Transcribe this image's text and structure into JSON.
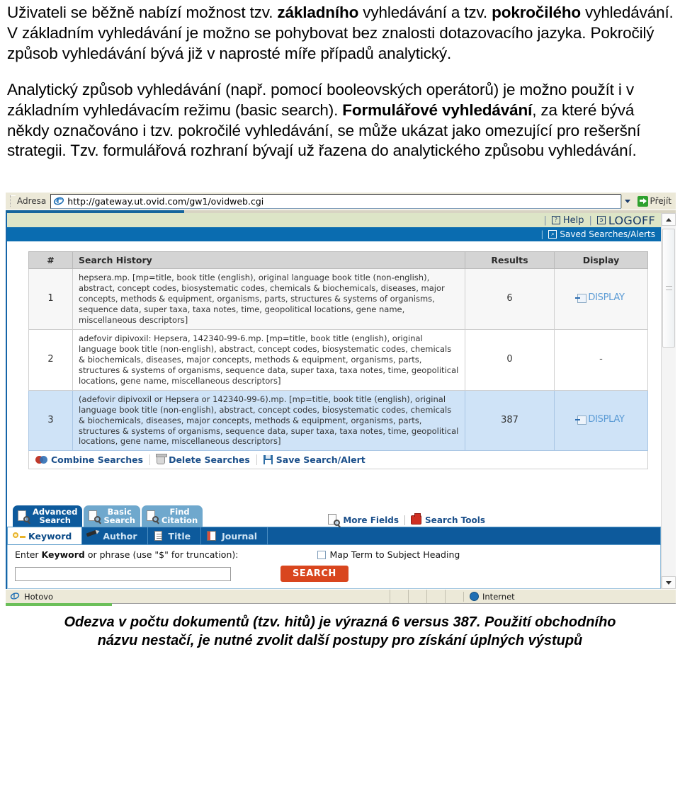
{
  "document": {
    "paragraph1_parts": [
      {
        "t": "Uživateli se běžně nabízí možnost tzv. ",
        "b": false
      },
      {
        "t": "základního",
        "b": true
      },
      {
        "t": " vyhledávání a tzv. ",
        "b": false
      },
      {
        "t": "pokročilého",
        "b": true
      },
      {
        "t": " vyhledávání. V základním vyhledávání je možno se pohybovat bez znalosti dotazovacího jazyka. Pokročilý způsob vyhledávání bývá již v naprosté míře případů analytický.",
        "b": false
      }
    ],
    "paragraph2_parts": [
      {
        "t": "Analytický způsob vyhledávání (např. pomocí booleovských operátorů) je možno použít i v základním vyhledávacím režimu (basic search). ",
        "b": false
      },
      {
        "t": "Formulářové vyhledávání",
        "b": true
      },
      {
        "t": ", za které bývá někdy označováno i tzv. pokročilé vyhledávání, se může ukázat jako omezující pro rešeršní strategii. Tzv. formulářová rozhraní bývají už řazena do analytického způsobu vyhledávání.",
        "b": false
      }
    ],
    "caption_line1": "Odezva v počtu dokumentů (tzv. hitů) je výrazná  6 versus 387. Použití obchodního",
    "caption_line2": "názvu nestačí, je nutné zvolit další postupy pro získání úplných výstupů"
  },
  "browser": {
    "address_label": "Adresa",
    "url": "http://gateway.ut.ovid.com/gw1/ovidweb.cgi",
    "go_label": "Přejít",
    "status_text": "Hotovo",
    "zone_text": "Internet"
  },
  "utility": {
    "help_label": "Help",
    "logoff_label": "LOGOFF",
    "saved_searches_label": "Saved Searches/Alerts",
    "separator": "|"
  },
  "history": {
    "columns": [
      "#",
      "Search History",
      "Results",
      "Display"
    ],
    "rows": [
      {
        "num": "1",
        "query": "hepsera.mp. [mp=title, book title (english), original language book title (non-english), abstract, concept codes, biosystematic codes, chemicals & biochemicals, diseases, major concepts, methods & equipment, organisms, parts, structures & systems of organisms, sequence data, super taxa, taxa notes, time, geopolitical locations, gene name, miscellaneous descriptors]",
        "results": "6",
        "display": "DISPLAY",
        "has_display": true,
        "selected": false
      },
      {
        "num": "2",
        "query": "adefovir dipivoxil: Hepsera, 142340-99-6.mp. [mp=title, book title (english), original language book title (non-english), abstract, concept codes, biosystematic codes, chemicals & biochemicals, diseases, major concepts, methods & equipment, organisms, parts, structures & systems of organisms, sequence data, super taxa, taxa notes, time, geopolitical locations, gene name, miscellaneous descriptors]",
        "results": "0",
        "display": "-",
        "has_display": false,
        "selected": false
      },
      {
        "num": "3",
        "query": "(adefovir dipivoxil or Hepsera or 142340-99-6).mp. [mp=title, book title (english), original language book title (non-english), abstract, concept codes, biosystematic codes, chemicals & biochemicals, diseases, major concepts, methods & equipment, organisms, parts, structures & systems of organisms, sequence data, super taxa, taxa notes, time, geopolitical locations, gene name, miscellaneous descriptors]",
        "results": "387",
        "display": "DISPLAY",
        "has_display": true,
        "selected": true
      }
    ],
    "actions": [
      {
        "label": "Combine Searches",
        "icon": "combine-icon"
      },
      {
        "label": "Delete Searches",
        "icon": "trash-icon"
      },
      {
        "label": "Save Search/Alert",
        "icon": "floppy-icon"
      }
    ]
  },
  "searchpanel": {
    "tabs": [
      {
        "line1": "Advanced",
        "line2": "Search",
        "active": true
      },
      {
        "line1": "Basic",
        "line2": "Search",
        "active": false
      },
      {
        "line1": "Find",
        "line2": "Citation",
        "active": false
      }
    ],
    "tools": [
      {
        "label": "More Fields",
        "icon": "more-fields-icon"
      },
      {
        "label": "Search Tools",
        "icon": "toolbox-icon"
      }
    ],
    "subtabs": [
      {
        "label": "Keyword",
        "icon": "key-icon",
        "active": true
      },
      {
        "label": "Author",
        "icon": "pen-icon",
        "active": false
      },
      {
        "label": "Title",
        "icon": "document-icon",
        "active": false
      },
      {
        "label": "Journal",
        "icon": "journal-icon",
        "active": false
      }
    ],
    "field_label_pre": "Enter ",
    "field_label_bold": "Keyword",
    "field_label_post": " or phrase (use \"$\" for truncation):",
    "map_term_label": "Map Term to Subject Heading",
    "keyword_value": "",
    "keyword_placeholder": "",
    "search_button": "SEARCH"
  }
}
